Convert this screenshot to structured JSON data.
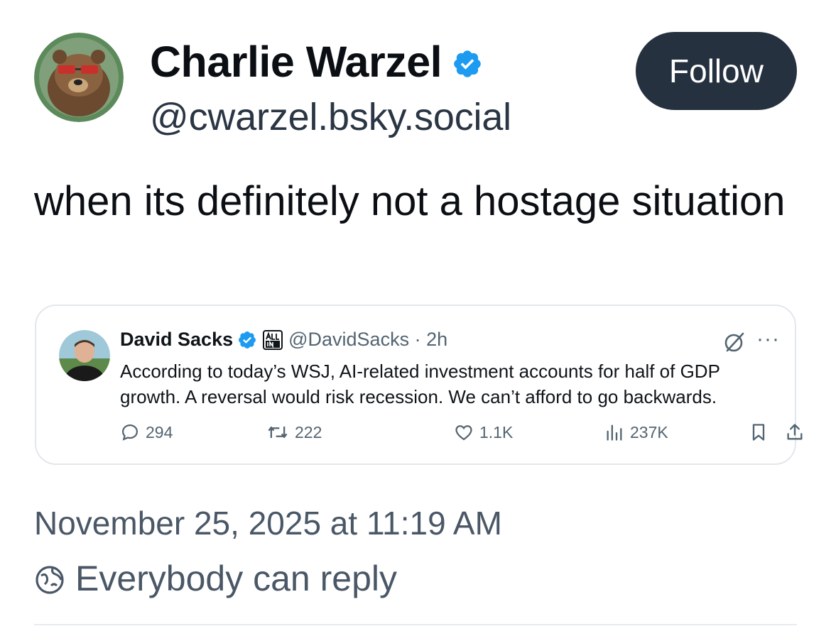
{
  "author": {
    "name": "Charlie Warzel",
    "handle": "@cwarzel.bsky.social",
    "follow_label": "Follow"
  },
  "post": {
    "text": "when its definitely not a hostage situation",
    "timestamp": "November 25, 2025 at 11:19 AM",
    "reply_setting": "Everybody can reply"
  },
  "quoted_post": {
    "name": "David Sacks",
    "handle_time": "@DavidSacks · 2h",
    "text": "According to today’s WSJ, AI-related investment accounts for half of GDP growth. A reversal would risk recession. We can’t afford to go backwards.",
    "stats": {
      "replies": "294",
      "reposts": "222",
      "likes": "1.1K",
      "views": "237K"
    }
  },
  "colors": {
    "follow_bg": "#26313f",
    "verified_blue": "#1d9bf0",
    "secondary_text": "#4a5766"
  },
  "icons": {
    "verified": "verified-badge-icon",
    "grok": "grok-icon",
    "more": "more-icon",
    "reply": "reply-icon",
    "repost": "repost-icon",
    "like": "heart-icon",
    "views": "views-icon",
    "bookmark": "bookmark-icon",
    "share": "share-icon",
    "reply_setting": "globe-icon"
  }
}
